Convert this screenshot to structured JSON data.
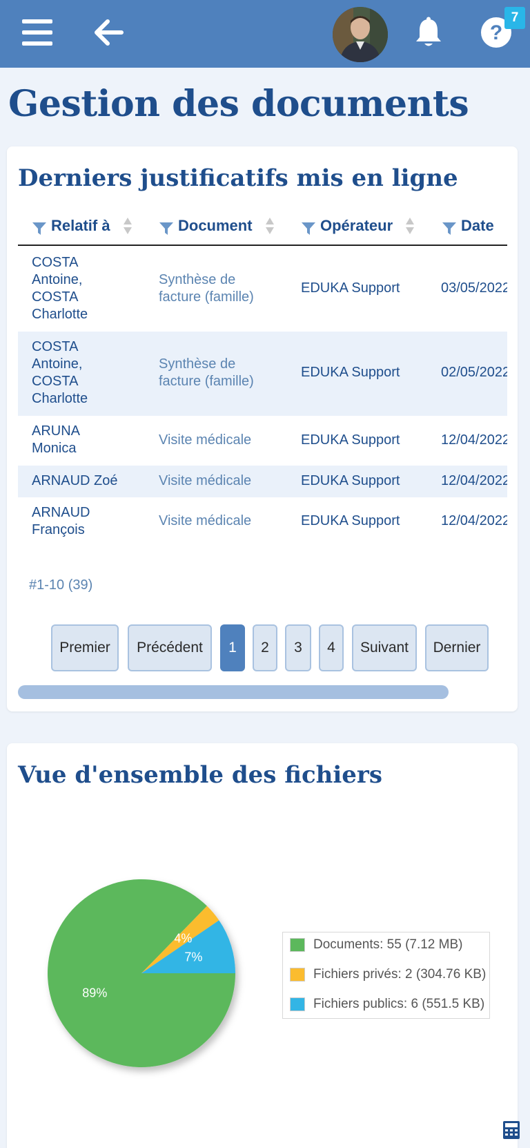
{
  "header": {
    "notification_count": "7",
    "icons": [
      "hamburger-menu-icon",
      "back-arrow-icon",
      "avatar",
      "bell-icon",
      "help-icon"
    ]
  },
  "page_title": "Gestion des documents",
  "uploads": {
    "title": "Derniers justificatifs mis en ligne",
    "columns": [
      "Relatif à",
      "Document",
      "Opérateur",
      "Date"
    ],
    "rows": [
      {
        "relatif": "COSTA\nAntoine,\nCOSTA\nCharlotte",
        "document": "Synthèse de\nfacture (famille)",
        "operateur": "EDUKA Support",
        "date": "03/05/2022"
      },
      {
        "relatif": "COSTA\nAntoine,\nCOSTA\nCharlotte",
        "document": "Synthèse de\nfacture (famille)",
        "operateur": "EDUKA Support",
        "date": "02/05/2022"
      },
      {
        "relatif": "ARUNA\nMonica",
        "document": "Visite médicale",
        "operateur": "EDUKA Support",
        "date": "12/04/2022"
      },
      {
        "relatif": "ARNAUD Zoé",
        "document": "Visite médicale",
        "operateur": "EDUKA Support",
        "date": "12/04/2022"
      },
      {
        "relatif": "ARNAUD\nFrançois",
        "document": "Visite médicale",
        "operateur": "EDUKA Support",
        "date": "12/04/2022"
      }
    ],
    "count_label": "#1-10 (39)",
    "pagination": {
      "first": "Premier",
      "prev": "Précédent",
      "pages": [
        "1",
        "2",
        "3",
        "4"
      ],
      "current": "1",
      "next": "Suivant",
      "last": "Dernier"
    }
  },
  "overview": {
    "title": "Vue d'ensemble des fichiers"
  },
  "chart_data": {
    "type": "pie",
    "title": "",
    "slices": [
      {
        "name": "Documents: 55 (7.12 MB)",
        "value": 55,
        "percent_label": "89%",
        "color": "#5cb85c"
      },
      {
        "name": "Fichiers privés: 2 (304.76 KB)",
        "value": 2,
        "percent_label": "4%",
        "color": "#fbbc2f"
      },
      {
        "name": "Fichiers publics: 6 (551.5 KB)",
        "value": 6,
        "percent_label": "7%",
        "color": "#33b5e5"
      }
    ],
    "legend_position": "right"
  },
  "colors": {
    "header_bg": "#4f81bd",
    "title_blue": "#1f4e8c",
    "badge": "#29b6e8",
    "row_alt": "#eaf1fa"
  }
}
